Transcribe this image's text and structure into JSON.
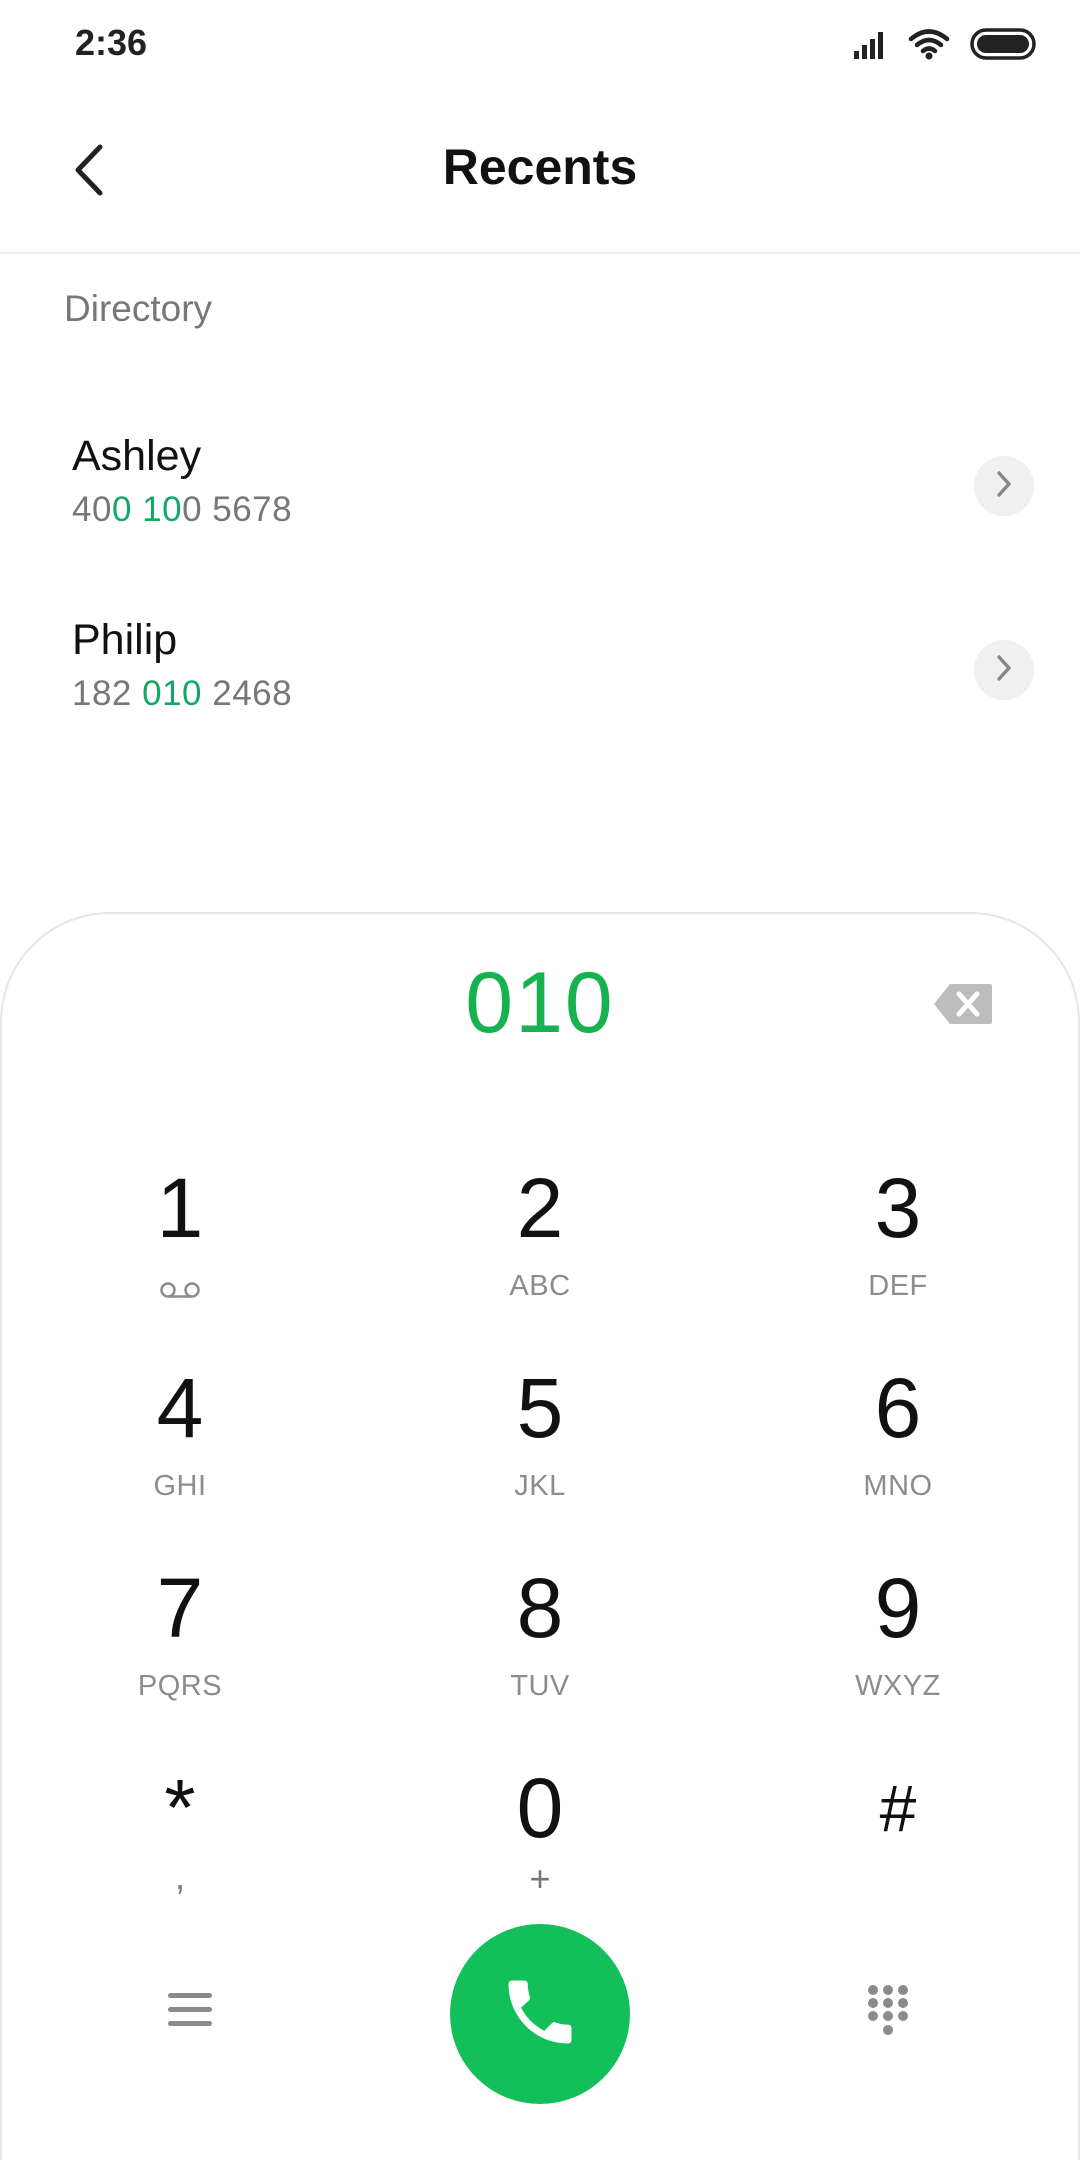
{
  "status_bar": {
    "time": "2:36",
    "icons": [
      "signal-icon",
      "wifi-icon",
      "battery-icon"
    ]
  },
  "header": {
    "title": "Recents",
    "back_icon": "chevron-left-icon"
  },
  "directory": {
    "label": "Directory",
    "contacts": [
      {
        "name": "Ashley",
        "number_parts": [
          {
            "text": "40",
            "match": false
          },
          {
            "text": "0 10",
            "match": true
          },
          {
            "text": "0 5678",
            "match": false
          }
        ]
      },
      {
        "name": "Philip",
        "number_parts": [
          {
            "text": "182 ",
            "match": false
          },
          {
            "text": "010",
            "match": true
          },
          {
            "text": " 2468",
            "match": false
          }
        ]
      }
    ]
  },
  "dialpad": {
    "dialed": "010",
    "backspace_icon": "backspace-icon",
    "keys": [
      {
        "digit": "1",
        "letters": ""
      },
      {
        "digit": "2",
        "letters": "ABC"
      },
      {
        "digit": "3",
        "letters": "DEF"
      },
      {
        "digit": "4",
        "letters": "GHI"
      },
      {
        "digit": "5",
        "letters": "JKL"
      },
      {
        "digit": "6",
        "letters": "MNO"
      },
      {
        "digit": "7",
        "letters": "PQRS"
      },
      {
        "digit": "8",
        "letters": "TUV"
      },
      {
        "digit": "9",
        "letters": "WXYZ"
      },
      {
        "digit": "*",
        "letters": ","
      },
      {
        "digit": "0",
        "letters": "+"
      },
      {
        "digit": "#",
        "letters": ""
      }
    ]
  },
  "bottom_bar": {
    "menu_icon": "menu-icon",
    "call_icon": "phone-icon",
    "dialpad_icon": "dialpad-icon"
  },
  "colors": {
    "accent_green": "#16b24f",
    "match_green": "#14a865",
    "call_button": "#12bf59"
  }
}
